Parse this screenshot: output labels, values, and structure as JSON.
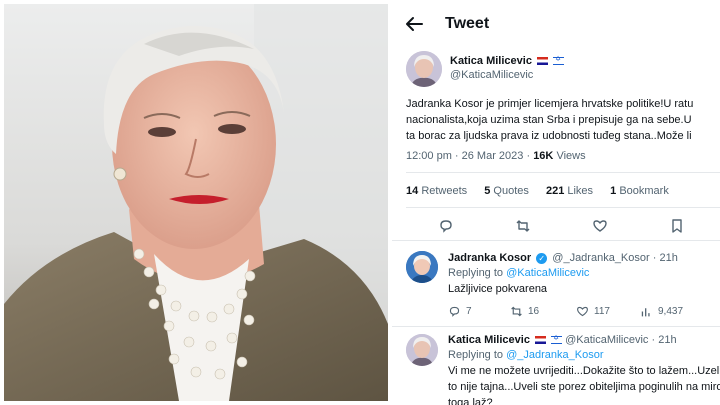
{
  "header": {
    "title": "Tweet"
  },
  "tweet": {
    "author_name": "Katica Milicevic",
    "author_handle": "@KaticaMilicevic",
    "text_lines": [
      "Jadranka Kosor je primjer licemjera hrvatske politike!U ratu",
      "nacionalista,koja uzima stan Srba i prepisuje ga na sebe.U",
      "ta borac za ljudska prava iz udobnosti tuđeg stana..Može li"
    ],
    "time": "12:00 pm · 26 Mar 2023 · ",
    "views_count": "16K",
    "views_label": "Views",
    "stats": {
      "retweets_count": "14",
      "retweets_label": "Retweets",
      "quotes_count": "5",
      "quotes_label": "Quotes",
      "likes_count": "221",
      "likes_label": "Likes",
      "bookmarks_count": "1",
      "bookmarks_label": "Bookmark"
    }
  },
  "replies": [
    {
      "author_name": "Jadranka Kosor",
      "author_handle": "@_Jadranka_Kosor",
      "time": "· 21h",
      "replying_to_label": "Replying to",
      "replying_to_handle": "@KaticaMilicevic",
      "text_lines": [
        "Lažljivice pokvarena"
      ],
      "reply_count": "7",
      "retweet_count": "16",
      "like_count": "117",
      "view_count": "9,437"
    },
    {
      "author_name": "Katica Milicevic",
      "author_handle": "@KaticaMilicevic",
      "time": "· 21h",
      "replying_to_label": "Replying to",
      "replying_to_handle": "@_Jadranka_Kosor",
      "text_lines": [
        "Vi me ne možete uvrijediti...Dokažite što to lažem...Uzeli st",
        "to nije tajna...Uveli ste porez obiteljima poginulih na mirov",
        "toga laž?"
      ]
    }
  ],
  "colors": {
    "accent": "#1d9bf0",
    "text": "#0f1419",
    "muted": "#536471"
  }
}
